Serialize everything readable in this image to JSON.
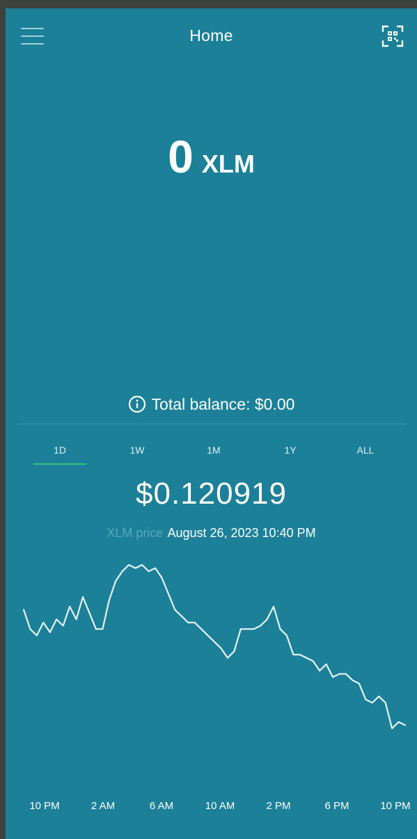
{
  "header": {
    "title": "Home",
    "menu_icon": "hamburger-menu-icon",
    "scan_icon": "qr-scan-icon"
  },
  "balance": {
    "amount": "0",
    "currency": "XLM",
    "total_label": "Total balance: $0.00"
  },
  "range_tabs": [
    "1D",
    "1W",
    "1M",
    "1Y",
    "ALL"
  ],
  "selected_range": "1D",
  "price": {
    "value": "$0.120919",
    "caption_label": "XLM price",
    "timestamp": "August 26, 2023 10:40 PM"
  },
  "colors": {
    "background": "#1c8098",
    "line": "#e6f4f7",
    "active_tab": "#35c27a"
  },
  "chart_data": {
    "type": "line",
    "x_tick_labels": [
      "10 PM",
      "2 AM",
      "6 AM",
      "10 AM",
      "2 PM",
      "6 PM",
      "10 PM"
    ],
    "grid": false,
    "series": [
      {
        "values": [
          0.1232,
          0.1226,
          0.1224,
          0.1228,
          0.1225,
          0.1229,
          0.1227,
          0.1233,
          0.1229,
          0.1236,
          0.1231,
          0.1226,
          0.1226,
          0.1235,
          0.1241,
          0.1244,
          0.1246,
          0.1245,
          0.1246,
          0.1244,
          0.1245,
          0.1242,
          0.1237,
          0.1232,
          0.123,
          0.1228,
          0.1228,
          0.1226,
          0.1224,
          0.1222,
          0.122,
          0.1217,
          0.1219,
          0.1226,
          0.1226,
          0.1226,
          0.1227,
          0.1229,
          0.1233,
          0.1226,
          0.1224,
          0.1218,
          0.1218,
          0.1217,
          0.1216,
          0.1213,
          0.1215,
          0.1211,
          0.1212,
          0.1212,
          0.121,
          0.1209,
          0.1204,
          0.1203,
          0.1205,
          0.1203,
          0.1195,
          0.1197,
          0.1196
        ]
      }
    ]
  }
}
